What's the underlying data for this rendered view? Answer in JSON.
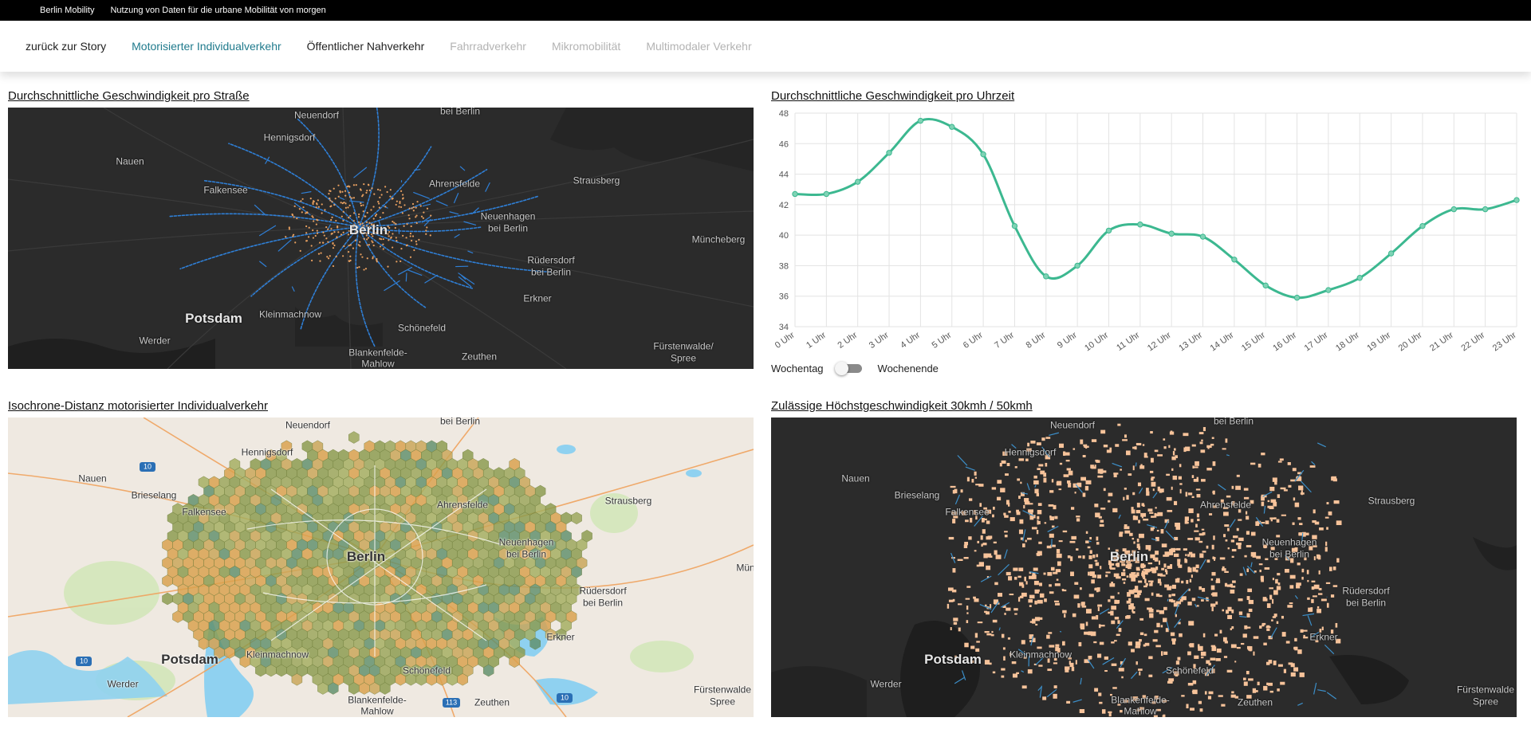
{
  "topbar": {
    "brand": "Berlin Mobility",
    "tagline": "Nutzung von Daten für die urbane Mobilität von morgen"
  },
  "nav": {
    "items": [
      {
        "label": "zurück zur Story",
        "color": "#222222"
      },
      {
        "label": "Motorisierter Individualverkehr",
        "color": "#1f7a8c"
      },
      {
        "label": "Öffentlicher Nahverkehr",
        "color": "#222222"
      },
      {
        "label": "Fahrradverkehr",
        "color": "#b3b3b3"
      },
      {
        "label": "Mikromobilität",
        "color": "#b3b3b3"
      },
      {
        "label": "Multimodaler Verkehr",
        "color": "#b3b3b3"
      }
    ]
  },
  "panels": {
    "speed_per_street": {
      "title": "Durchschnittliche Geschwindigkeit pro Straße"
    },
    "speed_per_hour": {
      "title": "Durchschnittliche Geschwindigkeit pro Uhrzeit"
    },
    "isochrone": {
      "title": "Isochrone-Distanz motorisierter Individualverkehr"
    },
    "max_speed": {
      "title": "Zulässige Höchstgeschwindigkeit 30kmh / 50kmh"
    }
  },
  "toggle": {
    "left_label": "Wochentag",
    "right_label": "Wochenende"
  },
  "map_labels": {
    "neuendorf": "Neuendorf",
    "bei_berlin_top": "bei Berlin",
    "hennigsdorf": "Hennigsdorf",
    "nauen": "Nauen",
    "brieselang": "Brieselang",
    "falkensee": "Falkensee",
    "ahrensfelde": "Ahrensfelde",
    "strausberg": "Strausberg",
    "neuenhagen": "Neuenhagen",
    "bei_berlin_neuenhagen": "bei Berlin",
    "berlin": "Berlin",
    "muencheberg": "Müncheberg",
    "ruedersdorf": "Rüdersdorf",
    "bei_berlin_ruedersdorf": "bei Berlin",
    "erkner": "Erkner",
    "potsdam": "Potsdam",
    "kleinmachnow": "Kleinmachnow",
    "schoenefeld": "Schönefeld",
    "werder": "Werder",
    "blankenfelde": "Blankenfelde-",
    "mahlow": "Mahlow",
    "zeuthen": "Zeuthen",
    "fuerstenwalde": "Fürstenwalde/",
    "spree": "Spree",
    "fuerstenwalde_cut": "Fürstenwalde",
    "muencheberg_cut": "Mün",
    "road_10": "10",
    "road_113": "113"
  },
  "colors": {
    "teal_line": "#3cb890",
    "dark_map": "#2b2b2b",
    "light_map": "#efe9e1",
    "street_blue": "#2f7fd6",
    "street_orange": "#e8a060",
    "speed_peach": "#f7c39a",
    "hex_olive": "#8a9a4c",
    "hex_orange": "#d9a04a"
  },
  "chart_data": {
    "type": "line",
    "title": "Durchschnittliche Geschwindigkeit pro Uhrzeit",
    "categories": [
      "0 Uhr",
      "1 Uhr",
      "2 Uhr",
      "3 Uhr",
      "4 Uhr",
      "5 Uhr",
      "6 Uhr",
      "7 Uhr",
      "8 Uhr",
      "9 Uhr",
      "10 Uhr",
      "11 Uhr",
      "12 Uhr",
      "13 Uhr",
      "14 Uhr",
      "15 Uhr",
      "16 Uhr",
      "17 Uhr",
      "18 Uhr",
      "19 Uhr",
      "20 Uhr",
      "21 Uhr",
      "22 Uhr",
      "23 Uhr"
    ],
    "series": [
      {
        "values": [
          42.7,
          42.7,
          43.5,
          45.4,
          47.5,
          47.1,
          45.3,
          40.6,
          37.3,
          38.0,
          40.3,
          40.7,
          40.1,
          39.9,
          38.4,
          36.7,
          35.9,
          36.4,
          37.2,
          38.8,
          40.6,
          41.7,
          41.7,
          42.3
        ]
      }
    ],
    "ylim": [
      34,
      48
    ],
    "yticks": [
      34,
      36,
      38,
      40,
      42,
      44,
      46,
      48
    ],
    "grid": true,
    "line_color": "#3cb890"
  }
}
